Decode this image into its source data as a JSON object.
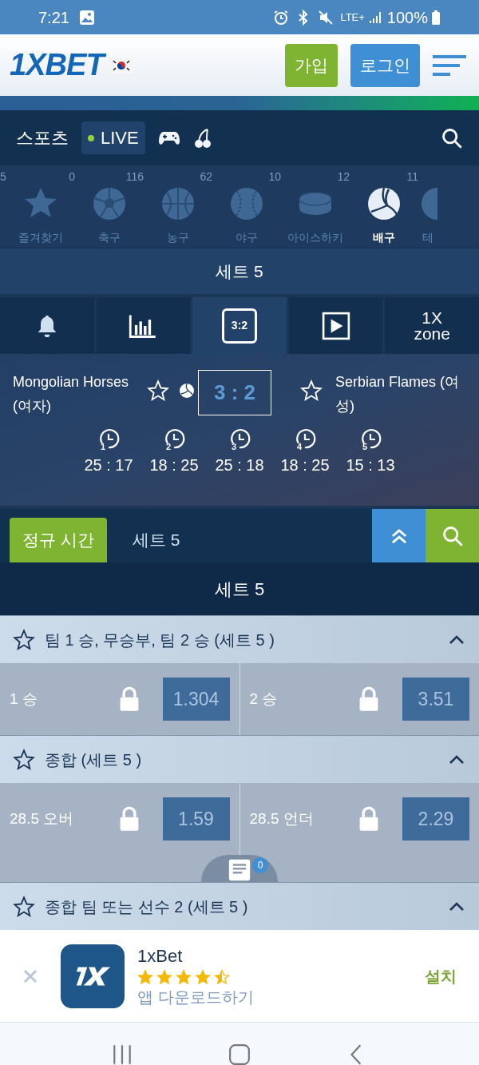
{
  "status_bar": {
    "time": "7:21",
    "battery": "100%",
    "network": "LTE+"
  },
  "header": {
    "logo": "1XBET",
    "buttons": [
      {
        "kind": "register",
        "label": "가입"
      },
      {
        "kind": "login",
        "label": "로그인"
      }
    ]
  },
  "nav": {
    "items": [
      {
        "kind": "text",
        "label": "스포츠",
        "selected": false
      },
      {
        "kind": "live",
        "label": "LIVE",
        "selected": true
      },
      {
        "kind": "games",
        "selected": false
      },
      {
        "kind": "slots",
        "selected": false
      }
    ]
  },
  "sports": {
    "lead_count": "5",
    "items": [
      {
        "kind": "star",
        "label": "즐겨찾기",
        "count": "0",
        "selected": false
      },
      {
        "kind": "soccer",
        "label": "축구",
        "count": "116",
        "selected": false
      },
      {
        "kind": "basketball",
        "label": "농구",
        "count": "62",
        "selected": false
      },
      {
        "kind": "baseball",
        "label": "야구",
        "count": "10",
        "selected": false
      },
      {
        "kind": "hockey",
        "label": "아이스하키",
        "count": "12",
        "selected": false
      },
      {
        "kind": "volleyball",
        "label": "배구",
        "count": "11",
        "selected": true
      },
      {
        "kind": "tennis",
        "label": "테",
        "selected": false
      }
    ]
  },
  "set_title": "세트 5",
  "match_tabs": [
    {
      "kind": "bell",
      "selected": false
    },
    {
      "kind": "stats",
      "selected": false
    },
    {
      "kind": "score",
      "label": "3:2",
      "selected": true
    },
    {
      "kind": "video",
      "selected": false
    },
    {
      "kind": "zone",
      "label": "1X",
      "label2": "zone",
      "selected": false
    }
  ],
  "match": {
    "team1": "Mongolian Horses (여자)",
    "team2": "Serbian Flames (여성)",
    "score": "3 : 2",
    "team1_serving": true,
    "team2_serving": false,
    "sets": [
      {
        "n": "1",
        "score": "25 : 17"
      },
      {
        "n": "2",
        "score": "18 : 25"
      },
      {
        "n": "3",
        "score": "25 : 18"
      },
      {
        "n": "4",
        "score": "18 : 25"
      },
      {
        "n": "5",
        "score": "15 : 13"
      }
    ]
  },
  "period_tabs": [
    {
      "label": "정규 시간",
      "selected": true
    },
    {
      "label": "세트 5",
      "selected": false
    }
  ],
  "section_title": "세트 5",
  "markets": [
    {
      "title": "팀 1 승, 무승부, 팀 2 승 (세트 5 )",
      "expanded": true,
      "odds": [
        {
          "label": "1 승",
          "value": "1.304",
          "locked": true
        },
        {
          "label": "2 승",
          "value": "3.51",
          "locked": true
        }
      ]
    },
    {
      "title": "종합 (세트 5 )",
      "expanded": true,
      "odds": [
        {
          "label": "28.5 오버",
          "value": "1.59",
          "locked": true
        },
        {
          "label": "28.5 언더",
          "value": "2.29",
          "locked": true
        }
      ]
    },
    {
      "title": "종합 팀 또는 선수 2 (세트 5 )",
      "expanded": true
    }
  ],
  "betslip": {
    "count": "0"
  },
  "app_banner": {
    "name": "1xBet",
    "stars": 4.5,
    "subtitle": "앱 다운로드하기",
    "install": "설치"
  }
}
